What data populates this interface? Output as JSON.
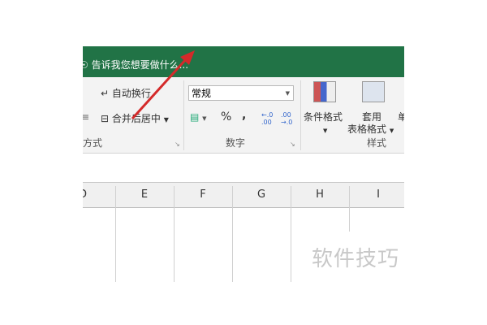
{
  "tell_me": "告诉我您想要做什么...",
  "alignment": {
    "wrap_text": "自动换行",
    "merge_center": "合并后居中",
    "group_label": "方式"
  },
  "number": {
    "format": "常规",
    "percent": "%",
    "comma": ",",
    "group_label": "数字"
  },
  "styles": {
    "conditional_format": "条件格式",
    "table_format_line1": "套用",
    "table_format_line2": "表格格式",
    "cell_styles_partial": "单",
    "group_label": "样式"
  },
  "columns": [
    "D",
    "E",
    "F",
    "G",
    "H",
    "I"
  ],
  "watermark": "软件技巧",
  "colors": {
    "green": "#217346",
    "arrow": "#d42a2a"
  }
}
